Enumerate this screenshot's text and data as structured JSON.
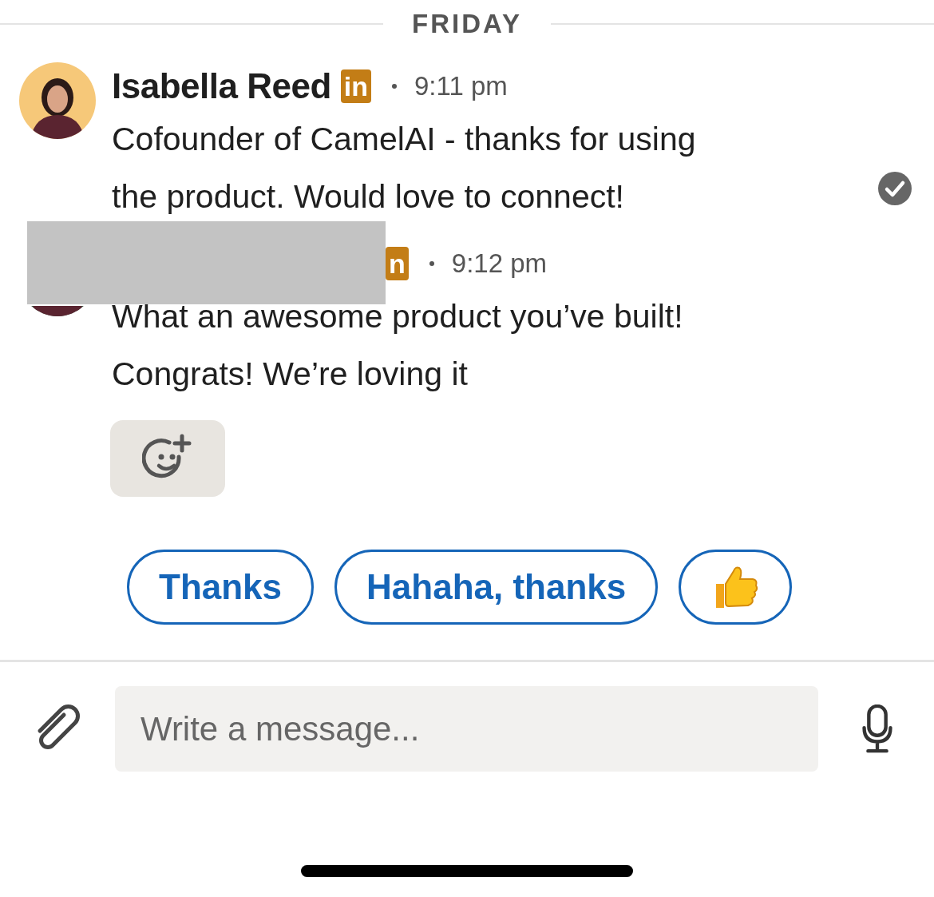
{
  "date_divider": "FRIDAY",
  "messages": [
    {
      "sender": "Isabella Reed",
      "redacted": false,
      "badge": "in",
      "time": "9:11 pm",
      "lines": [
        "Cofounder of CamelAI - thanks for using",
        "the product. Would love to connect!"
      ],
      "read": true
    },
    {
      "redacted": true,
      "badge": "n",
      "time": "9:12 pm",
      "lines": [
        "What an awesome product you’ve built!",
        "Congrats! We’re loving it"
      ],
      "read": false
    }
  ],
  "quick_replies": [
    {
      "kind": "text",
      "label": "Thanks"
    },
    {
      "kind": "text",
      "label": "Hahaha, thanks"
    },
    {
      "kind": "thumbs-up"
    }
  ],
  "composer": {
    "placeholder": "Write a message..."
  }
}
